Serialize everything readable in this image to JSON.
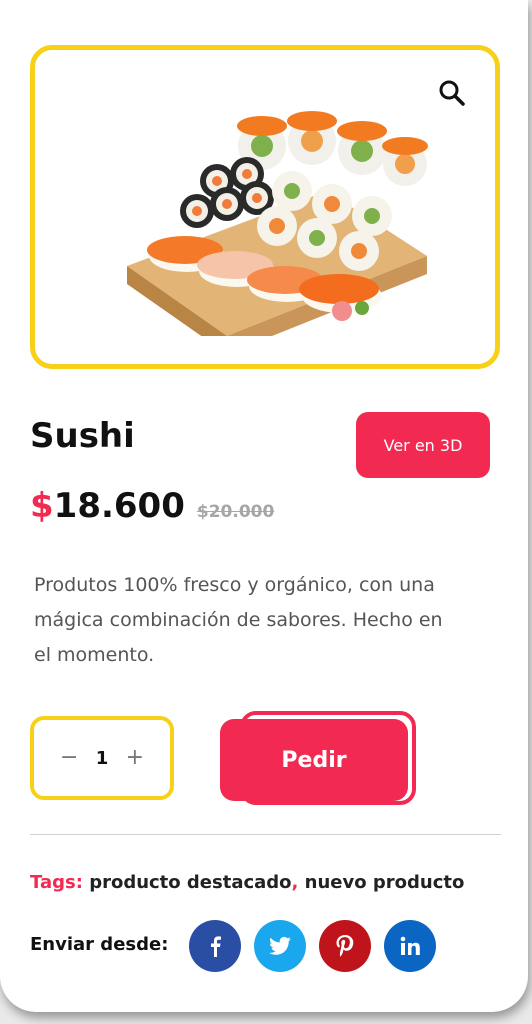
{
  "product": {
    "title": "Sushi",
    "view_3d_label": "Ver en 3D",
    "currency_symbol": "$",
    "price": "18.600",
    "old_price": "$20.000",
    "description": "Produtos 100% fresco y orgánico, con una mágica combinación de sabores. Hecho en el momento."
  },
  "quantity": {
    "value": "1",
    "minus": "−",
    "plus": "+"
  },
  "order": {
    "button_label": "Pedir"
  },
  "tags": {
    "label": "Tags:",
    "items": [
      "producto destacado",
      "nuevo producto"
    ],
    "separator": ","
  },
  "share": {
    "label": "Enviar desde:",
    "networks": [
      {
        "icon": "facebook-icon",
        "glyph": "f",
        "color": "#2a4ea3"
      },
      {
        "icon": "twitter-icon",
        "glyph": "t",
        "color": "#1aa7ee"
      },
      {
        "icon": "pinterest-icon",
        "glyph": "p",
        "color": "#c0141c"
      },
      {
        "icon": "linkedin-icon",
        "glyph": "in",
        "color": "#0a66c2"
      }
    ]
  },
  "colors": {
    "accent": "#f22a52",
    "highlight": "#f7d117"
  }
}
